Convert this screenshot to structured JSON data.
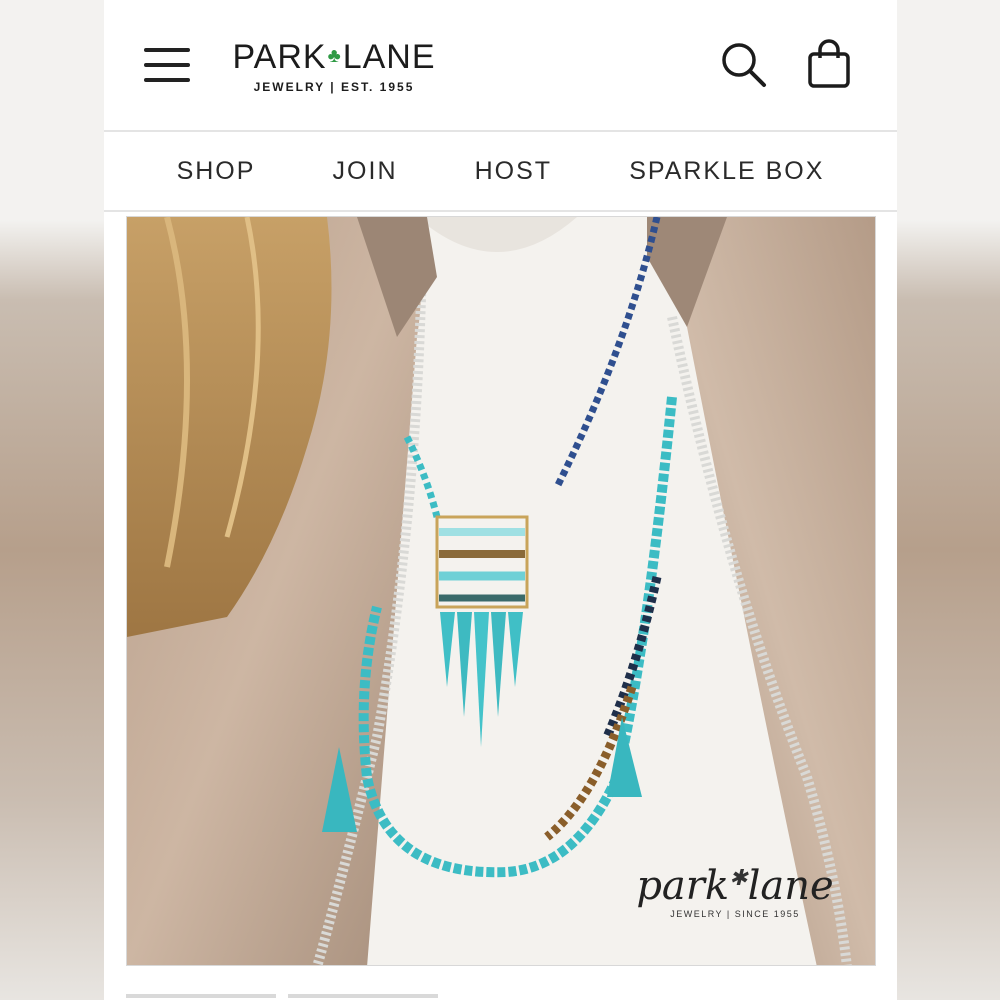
{
  "header": {
    "logo_wordmark_left": "PARK",
    "logo_wordmark_right": "LANE",
    "logo_tagline": "JEWELRY | EST. 1955"
  },
  "nav": {
    "items": [
      {
        "label": "SHOP"
      },
      {
        "label": "JOIN"
      },
      {
        "label": "HOST"
      },
      {
        "label": "SPARKLE BOX"
      }
    ]
  },
  "hero": {
    "brand_wordmark_left": "park",
    "brand_wordmark_right": "lane",
    "brand_sub": "JEWELRY | SINCE 1955"
  },
  "icons": {
    "menu": "hamburger-menu-icon",
    "search": "search-icon",
    "bag": "shopping-bag-icon",
    "clover": "shamrock-icon"
  },
  "colors": {
    "accent_clover": "#2f9a45",
    "nav_text": "#2a2a2a",
    "turquoise": "#3cbcc4"
  }
}
